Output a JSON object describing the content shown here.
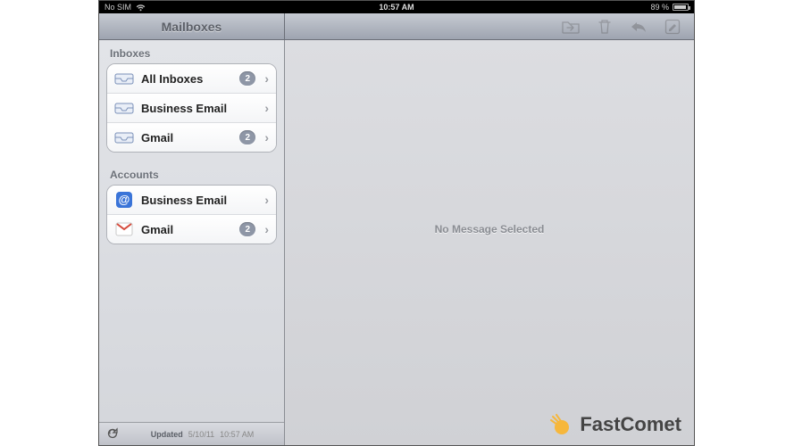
{
  "statusbar": {
    "carrier": "No SIM",
    "time": "10:57 AM",
    "battery_percent": "89 %"
  },
  "toolbar": {
    "title": "Mailboxes"
  },
  "sidebar": {
    "sections": {
      "inboxes_label": "Inboxes",
      "accounts_label": "Accounts"
    },
    "inboxes": [
      {
        "label": "All Inboxes",
        "badge": "2"
      },
      {
        "label": "Business Email",
        "badge": null
      },
      {
        "label": "Gmail",
        "badge": "2"
      }
    ],
    "accounts": [
      {
        "label": "Business Email",
        "badge": null
      },
      {
        "label": "Gmail",
        "badge": "2"
      }
    ]
  },
  "footer": {
    "updated_label": "Updated",
    "updated_date": "5/10/11",
    "updated_time": "10:57 AM"
  },
  "content": {
    "empty_message": "No Message Selected"
  },
  "watermark": {
    "brand": "FastComet"
  }
}
